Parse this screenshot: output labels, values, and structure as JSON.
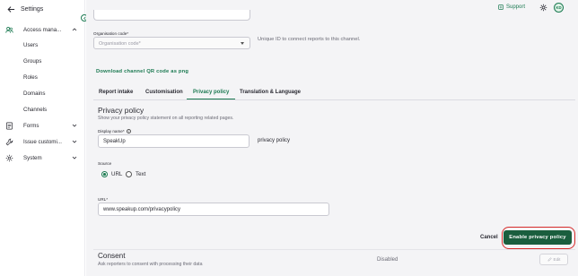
{
  "sidebar": {
    "back_label": "Settings",
    "items": [
      {
        "label": "Access mana...",
        "icon": "users-icon"
      },
      {
        "label": "Forms",
        "icon": "forms-icon"
      },
      {
        "label": "Issue customi...",
        "icon": "wrench-icon"
      },
      {
        "label": "System",
        "icon": "gear-icon"
      }
    ],
    "sub_items": [
      "Users",
      "Groups",
      "Roles",
      "Domains",
      "Channels"
    ]
  },
  "header": {
    "support_label": "Support",
    "avatar_initials": "KD"
  },
  "org_code": {
    "label": "Organisation code*",
    "placeholder": "Organisation code*",
    "help": "Unique ID to connect reports to this channel."
  },
  "qr_link": "Download channel QR code as png",
  "tabs": [
    "Report intake",
    "Customisation",
    "Privacy policy",
    "Translation & Language"
  ],
  "active_tab": "Privacy policy",
  "privacy": {
    "title": "Privacy policy",
    "description": "Show your privacy policy statement on all reporting related pages.",
    "display_name_label": "Display name*",
    "display_name_value": "SpeakUp",
    "display_name_suffix": "privacy policy",
    "source_label": "Source",
    "source_options": [
      "URL",
      "Text"
    ],
    "source_selected": "URL",
    "url_label": "URL*",
    "url_value": "www.speakup.com/privacypolicy"
  },
  "actions": {
    "cancel": "Cancel",
    "enable": "Enable privacy policy"
  },
  "consent": {
    "title": "Consent",
    "description": "Ask reporters to consent with processing their data",
    "status": "Disabled",
    "edit": "Edit"
  },
  "colors": {
    "accent": "#1c7a52",
    "button": "#1a5e3e",
    "highlight": "#d62a2a"
  }
}
